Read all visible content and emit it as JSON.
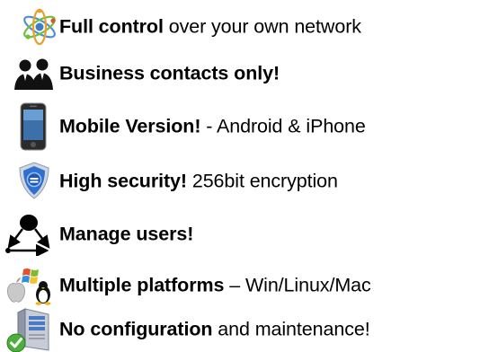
{
  "features": [
    {
      "icon": "atom-network-icon",
      "bold": "Full control",
      "rest": " over your own network"
    },
    {
      "icon": "business-people-icon",
      "bold": "Business contacts only!",
      "rest": ""
    },
    {
      "icon": "smartphone-icon",
      "bold": "Mobile Version!",
      "rest": " -  Android & iPhone"
    },
    {
      "icon": "security-shield-icon",
      "bold": "High security!",
      "rest": " 256bit encryption"
    },
    {
      "icon": "user-network-icon",
      "bold": "Manage users!",
      "rest": ""
    },
    {
      "icon": "os-logos-icon",
      "bold": "Multiple platforms",
      "rest": " – Win/Linux/Mac"
    },
    {
      "icon": "server-check-icon",
      "bold": "No configuration",
      "rest": " and maintenance!"
    }
  ]
}
